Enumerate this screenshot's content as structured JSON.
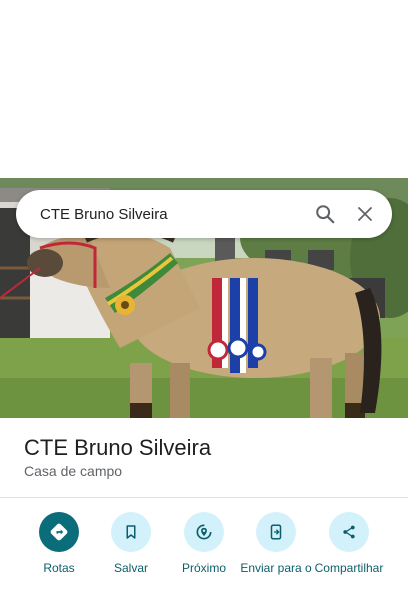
{
  "search": {
    "query": "CTE Bruno Silveira"
  },
  "place": {
    "title": "CTE Bruno Silveira",
    "category": "Casa de campo"
  },
  "actions": [
    {
      "label": "Rotas",
      "icon": "directions-icon",
      "primary": true
    },
    {
      "label": "Salvar",
      "icon": "bookmark-icon",
      "primary": false
    },
    {
      "label": "Próximo",
      "icon": "nearby-icon",
      "primary": false
    },
    {
      "label": "Enviar para o",
      "icon": "send-to-phone-icon",
      "primary": false
    },
    {
      "label": "Compartilhar",
      "icon": "share-icon",
      "primary": false
    }
  ],
  "colors": {
    "primary_action": "#0b6c7a",
    "secondary_action_bg": "#d3f1fb",
    "action_label": "#0b5f6b"
  }
}
